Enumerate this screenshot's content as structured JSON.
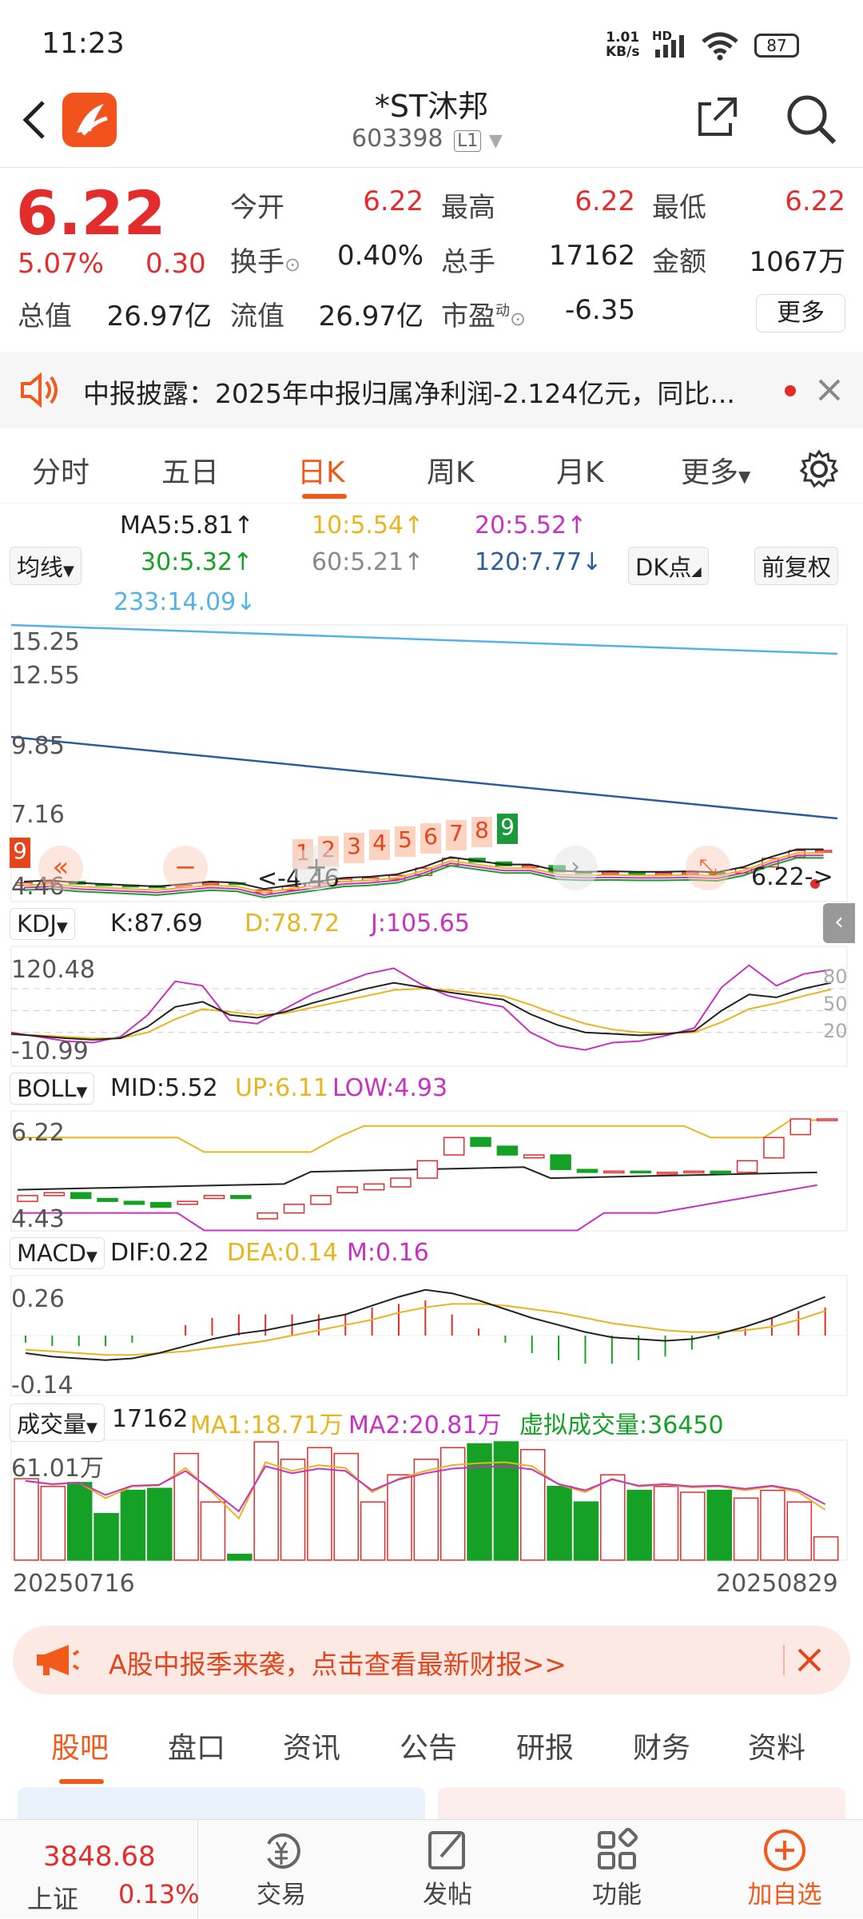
{
  "status": {
    "time": "11:23",
    "net_speed": "1.01",
    "net_unit": "KB/s",
    "net_type": "HD",
    "battery": "87"
  },
  "header": {
    "name": "*ST沐邦",
    "code": "603398",
    "level": "L1"
  },
  "quote": {
    "price": "6.22",
    "change_pct": "5.07%",
    "change": "0.30",
    "open_label": "今开",
    "open": "6.22",
    "high_label": "最高",
    "high": "6.22",
    "low_label": "最低",
    "low": "6.22",
    "turnover_label": "换手",
    "turnover": "0.40%",
    "volume_label": "总手",
    "volume": "17162",
    "amount_label": "金额",
    "amount": "1067万",
    "mcap_label": "总值",
    "mcap": "26.97亿",
    "float_label": "流值",
    "float_cap": "26.97亿",
    "pe_label": "市盈",
    "pe_sup": "动",
    "pe": "-6.35",
    "more": "更多"
  },
  "notice": {
    "text": "中报披露：2025年中报归属净利润-2.124亿元，同比..."
  },
  "ktabs": [
    "分时",
    "五日",
    "日K",
    "周K",
    "月K",
    "更多"
  ],
  "active_ktab": "日K",
  "ma": {
    "selector": "均线",
    "ma5": "MA5:5.81↑",
    "ma10": "10:5.54↑",
    "ma20": "20:5.52↑",
    "ma30": "30:5.32↑",
    "ma60": "60:5.21↑",
    "ma120": "120:7.77↓",
    "ma233": "233:14.09↓",
    "dk": "DK点",
    "fq": "前复权"
  },
  "main_axis": {
    "y1": "15.25",
    "y2": "12.55",
    "y3": "9.85",
    "y4": "7.16",
    "y5": "4.46"
  },
  "nine_turn": [
    "1",
    "2",
    "3",
    "4",
    "5",
    "6",
    "7",
    "8",
    "9"
  ],
  "nine_left": "9",
  "low_mark": "<-4.46",
  "price_mark": "6.22->",
  "kdj": {
    "selector": "KDJ",
    "k": "K:87.69",
    "d": "D:78.72",
    "j": "J:105.65",
    "top": "120.48",
    "bottom": "-10.99",
    "l80": "80",
    "l50": "50",
    "l20": "20"
  },
  "boll": {
    "selector": "BOLL",
    "mid": "MID:5.52",
    "up": "UP:6.11",
    "low": "LOW:4.93",
    "top": "6.22",
    "bottom": "4.43"
  },
  "macd": {
    "selector": "MACD",
    "dif": "DIF:0.22",
    "dea": "DEA:0.14",
    "m": "M:0.16",
    "top": "0.26",
    "bottom": "-0.14"
  },
  "vol": {
    "selector": "成交量",
    "v": "17162",
    "ma1": "MA1:18.71万",
    "ma2": "MA2:20.81万",
    "virtual": "虚拟成交量:36450",
    "top": "61.01万"
  },
  "dates": {
    "start": "20250716",
    "end": "20250829"
  },
  "banner": {
    "text": "A股中报季来袭，点击查看最新财报>>"
  },
  "btabs": [
    "股吧",
    "盘口",
    "资讯",
    "公告",
    "研报",
    "财务",
    "资料"
  ],
  "active_btab": "股吧",
  "index": {
    "value": "3848.68",
    "name": "上证",
    "pct": "0.13%"
  },
  "nav": [
    {
      "label": "交易"
    },
    {
      "label": "发帖"
    },
    {
      "label": "功能"
    },
    {
      "label": "加自选"
    }
  ],
  "colors": {
    "up": "#e32c2c",
    "down": "#15a126",
    "accent": "#f25a1c",
    "ma10": "#e8b51e",
    "ma20": "#c931c2",
    "ma233": "#53b3e8",
    "ma120": "#2a5d9c"
  },
  "chart_data": {
    "type": "candlestick",
    "dates": [
      "20250716",
      "20250829"
    ],
    "kdj_k": [
      18,
      15,
      12,
      10,
      12,
      28,
      55,
      62,
      44,
      40,
      48,
      60,
      70,
      80,
      88,
      82,
      75,
      70,
      65,
      45,
      30,
      20,
      18,
      16,
      18,
      22,
      50,
      72,
      68,
      80,
      88
    ],
    "kdj_d": [
      17,
      16,
      14,
      12,
      12,
      20,
      38,
      52,
      48,
      44,
      46,
      54,
      62,
      70,
      78,
      80,
      78,
      74,
      70,
      58,
      44,
      32,
      24,
      20,
      19,
      20,
      34,
      52,
      60,
      70,
      79
    ],
    "kdj_j": [
      20,
      14,
      8,
      6,
      14,
      44,
      90,
      84,
      36,
      32,
      52,
      72,
      86,
      100,
      108,
      86,
      70,
      62,
      55,
      20,
      2,
      -4,
      6,
      8,
      16,
      26,
      82,
      112,
      84,
      100,
      106
    ],
    "closes": [
      4.9,
      4.95,
      4.85,
      4.8,
      4.75,
      4.7,
      4.8,
      4.9,
      4.85,
      4.6,
      4.75,
      4.9,
      5.05,
      5.1,
      5.2,
      5.5,
      5.9,
      5.75,
      5.6,
      5.6,
      5.35,
      5.3,
      5.32,
      5.3,
      5.3,
      5.32,
      5.28,
      5.5,
      5.9,
      6.22,
      6.22
    ],
    "opens": [
      4.8,
      4.9,
      4.95,
      4.85,
      4.8,
      4.78,
      4.75,
      4.85,
      4.9,
      4.5,
      4.6,
      4.75,
      4.95,
      5.0,
      5.05,
      5.2,
      5.6,
      5.9,
      5.75,
      5.55,
      5.6,
      5.35,
      5.3,
      5.32,
      5.28,
      5.3,
      5.32,
      5.3,
      5.55,
      5.95,
      6.22
    ],
    "volumes": [
      42,
      38,
      40,
      24,
      36,
      37,
      55,
      30,
      3,
      61,
      52,
      58,
      55,
      30,
      44,
      52,
      58,
      60,
      61,
      57,
      38,
      30,
      44,
      36,
      38,
      35,
      36,
      32,
      36,
      30,
      12
    ],
    "macd_dif": [
      -0.1,
      -0.12,
      -0.13,
      -0.14,
      -0.13,
      -0.1,
      -0.06,
      -0.02,
      0.01,
      0.03,
      0.06,
      0.09,
      0.12,
      0.17,
      0.22,
      0.26,
      0.24,
      0.2,
      0.15,
      0.1,
      0.06,
      0.02,
      -0.01,
      -0.02,
      -0.03,
      -0.02,
      0.01,
      0.05,
      0.1,
      0.16,
      0.22
    ],
    "macd_dea": [
      -0.08,
      -0.09,
      -0.1,
      -0.11,
      -0.11,
      -0.1,
      -0.09,
      -0.07,
      -0.05,
      -0.03,
      0.0,
      0.03,
      0.06,
      0.09,
      0.13,
      0.16,
      0.18,
      0.18,
      0.17,
      0.15,
      0.13,
      0.1,
      0.07,
      0.05,
      0.03,
      0.02,
      0.02,
      0.03,
      0.05,
      0.09,
      0.14
    ]
  }
}
